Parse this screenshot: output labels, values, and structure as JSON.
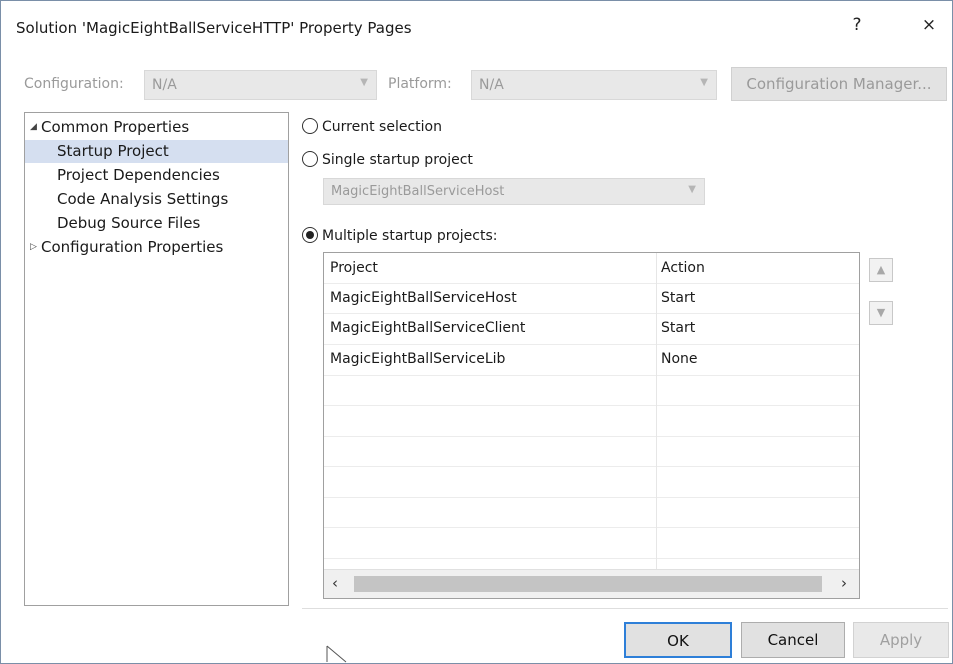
{
  "window": {
    "title": "Solution 'MagicEightBallServiceHTTP' Property Pages",
    "help_label": "?",
    "close_label": "×"
  },
  "config_bar": {
    "configuration_label": "Configuration:",
    "configuration_value": "N/A",
    "platform_label": "Platform:",
    "platform_value": "N/A",
    "configuration_manager_label": "Configuration Manager..."
  },
  "tree": {
    "items": [
      {
        "label": "Common Properties",
        "expander": "◢",
        "selected": false
      },
      {
        "label": "Startup Project",
        "selected": true
      },
      {
        "label": "Project Dependencies",
        "selected": false
      },
      {
        "label": "Code Analysis Settings",
        "selected": false
      },
      {
        "label": "Debug Source Files",
        "selected": false
      },
      {
        "label": "Configuration Properties",
        "expander": "▷",
        "selected": false
      }
    ]
  },
  "startup": {
    "current_selection_label": "Current selection",
    "single_startup_label": "Single startup project",
    "single_startup_value": "MagicEightBallServiceHost",
    "multiple_startup_label": "Multiple startup projects:",
    "selected_option": "multiple"
  },
  "grid": {
    "headers": {
      "project": "Project",
      "action": "Action"
    },
    "rows": [
      {
        "project": "MagicEightBallServiceHost",
        "action": "Start"
      },
      {
        "project": "MagicEightBallServiceClient",
        "action": "Start"
      },
      {
        "project": "MagicEightBallServiceLib",
        "action": "None"
      }
    ],
    "scroll_left": "‹",
    "scroll_right": "›",
    "move_up": "▲",
    "move_down": "▼"
  },
  "buttons": {
    "ok": "OK",
    "cancel": "Cancel",
    "apply": "Apply"
  },
  "colors": {
    "selection_highlight": "#d5dff0",
    "default_button_border": "#2e7fd8",
    "disabled_text": "#9a9a9a"
  }
}
